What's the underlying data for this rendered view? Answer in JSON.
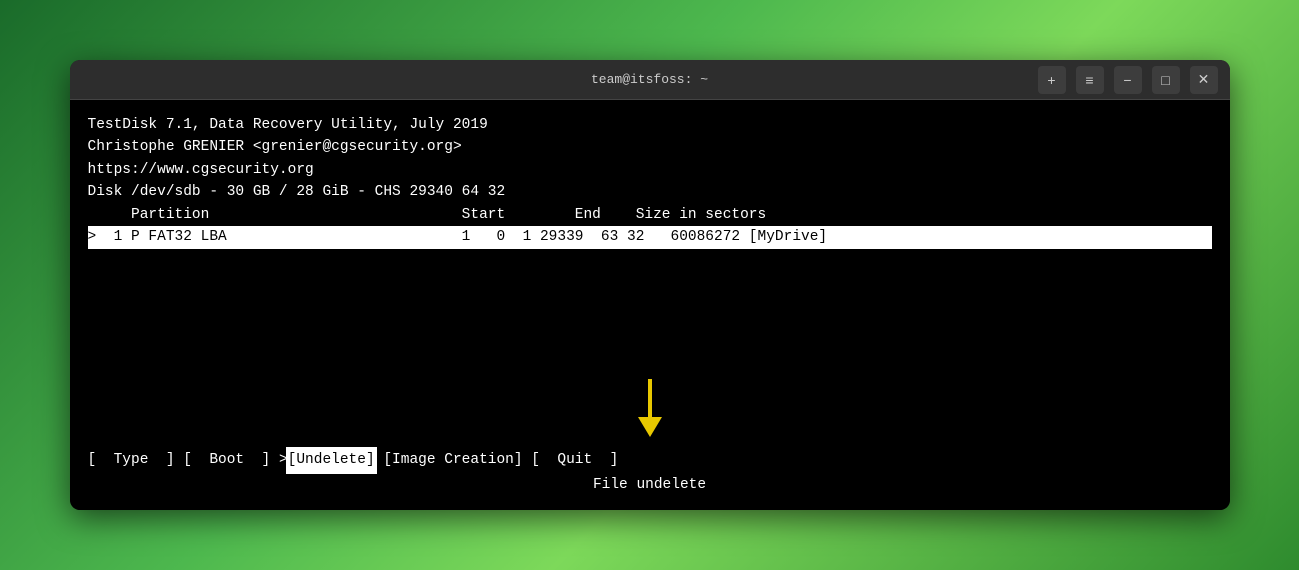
{
  "window": {
    "title": "team@itsfoss: ~",
    "controls": {
      "new_tab": "+",
      "menu": "≡",
      "minimize": "−",
      "maximize": "□",
      "close": "✕"
    }
  },
  "terminal": {
    "lines": [
      "TestDisk 7.1, Data Recovery Utility, July 2019",
      "Christophe GRENIER <grenier@cgsecurity.org>",
      "https://www.cgsecurity.org",
      "",
      "Disk /dev/sdb - 30 GB / 28 GiB - CHS 29340 64 32"
    ],
    "table_header": "     Partition                             Start        End    Size in sectors",
    "partition_row": ">  1 P FAT32 LBA                           1   0  1 29339  63 32   60086272 [MyDrive]",
    "menu_line": "[  Type  ] [  Boot  ] >[Undelete] [Image Creation] [  Quit  ]",
    "menu_parts": {
      "type": "[  Type  ]",
      "boot": "[  Boot  ]",
      "arrow": ">",
      "undelete": "[Undelete]",
      "image_creation": "[Image Creation]",
      "quit": "[  Quit  ]"
    },
    "status_line": "File undelete"
  }
}
